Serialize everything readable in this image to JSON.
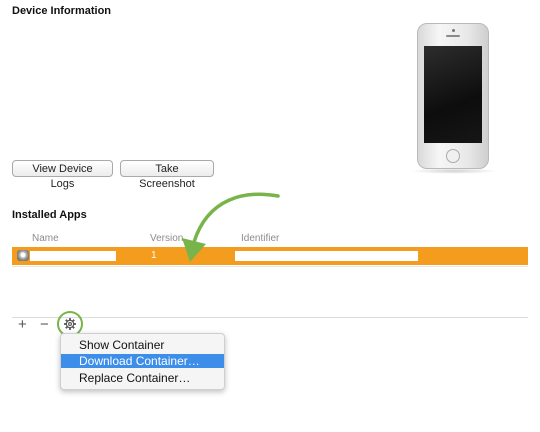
{
  "device_info": {
    "title": "Device Information",
    "view_logs_label": "View Device Logs",
    "take_screenshot_label": "Take Screenshot"
  },
  "installed_apps": {
    "title": "Installed Apps",
    "columns": [
      "Name",
      "Version",
      "Identifier"
    ],
    "rows": [
      {
        "name": "",
        "version": "1",
        "identifier": ""
      }
    ],
    "add_label": "+",
    "remove_label": "−"
  },
  "context_menu": {
    "items": [
      "Show Container",
      "Download Container…",
      "Replace Container…"
    ],
    "highlighted_index": 1
  },
  "colors": {
    "selection_row": "#f39c1e",
    "menu_highlight": "#3d8ee8",
    "annotation_green": "#79b44a"
  },
  "icons": [
    "gear-icon",
    "app-icon",
    "iphone-image",
    "annotation-arrow"
  ]
}
